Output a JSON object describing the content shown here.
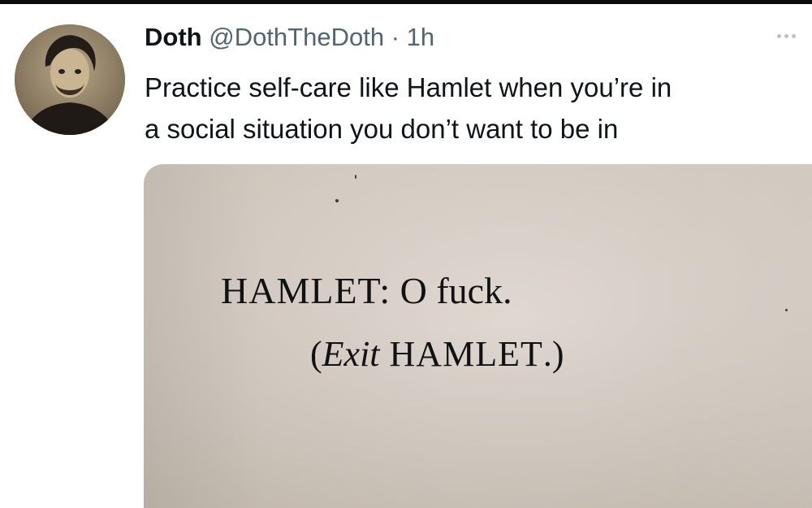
{
  "tweet": {
    "display_name": "Doth",
    "handle": "@DothTheDoth",
    "separator": " · ",
    "time": "1h",
    "more_icon": "ellipsis-icon",
    "text_line1": "Practice self-care like Hamlet when you’re in",
    "text_line2": "a social situation you don’t want to be in"
  },
  "media": {
    "speaker": "HAMLET:",
    "dialogue": " O fuck.",
    "stage_open": "(",
    "stage_exit": "Exit",
    "stage_name": " HAMLET",
    "stage_close": ".)"
  }
}
